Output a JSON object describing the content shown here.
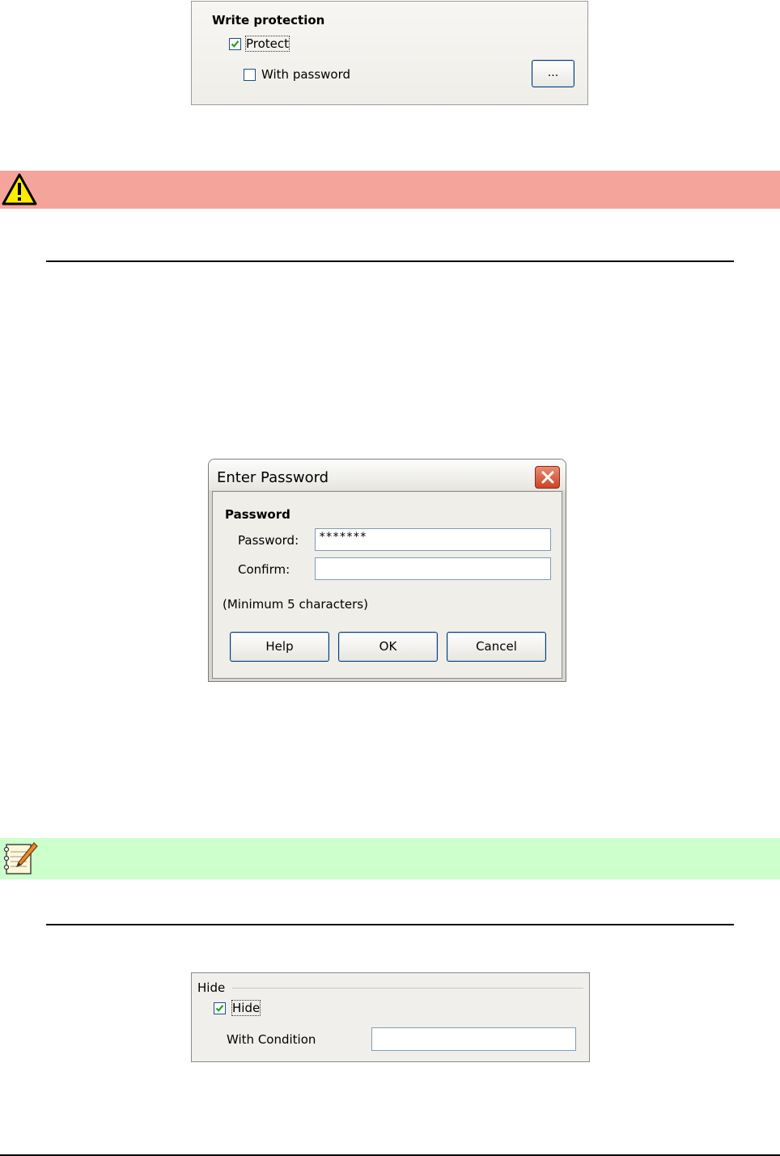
{
  "write_protection": {
    "title": "Write protection",
    "protect_label": "Protect",
    "protect_checked": true,
    "with_password_label": "With password",
    "with_password_checked": false,
    "dots_button": "..."
  },
  "enter_password_dialog": {
    "title": "Enter Password",
    "group_label": "Password",
    "password_label": "Password:",
    "password_value": "*******",
    "confirm_label": "Confirm:",
    "confirm_value": "",
    "hint": "(Minimum 5 characters)",
    "buttons": {
      "help": "Help",
      "ok": "OK",
      "cancel": "Cancel"
    }
  },
  "hide": {
    "title": "Hide",
    "hide_label": "Hide",
    "hide_checked": true,
    "with_condition_label": "With Condition",
    "condition_value": ""
  },
  "colors": {
    "warning_band": "#f5a49c",
    "note_band": "#ccffcc",
    "check_mark": "#21a121"
  },
  "icons": {
    "warning": "warning-triangle-icon",
    "note": "note-pencil-icon",
    "close": "close-icon"
  }
}
